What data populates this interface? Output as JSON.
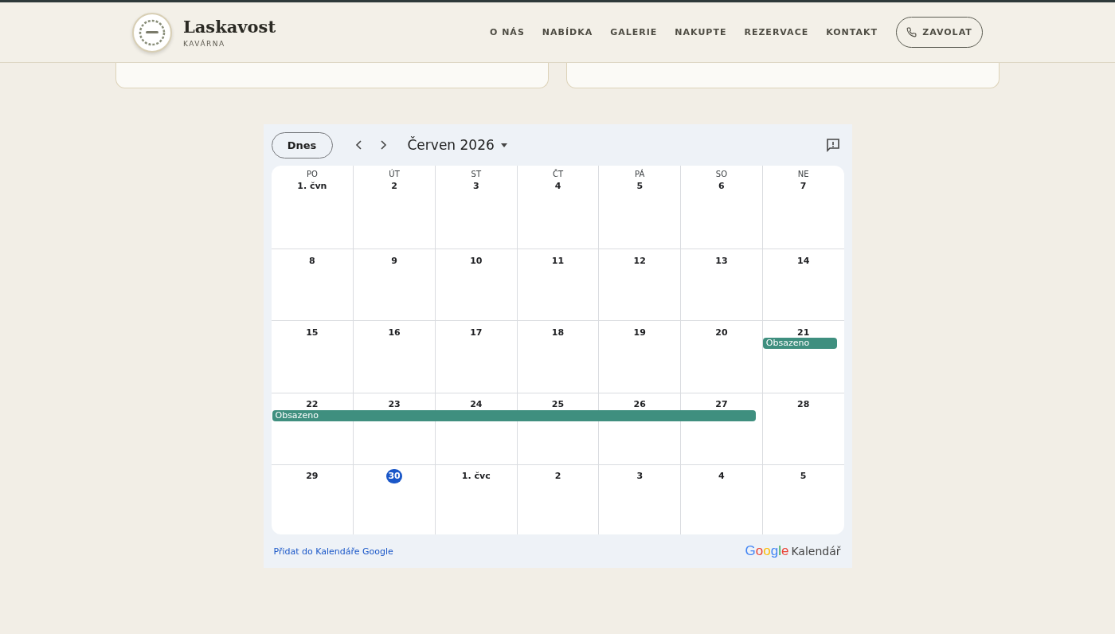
{
  "header": {
    "brand": "Laskavost",
    "tagline": "KAVÁRNA",
    "nav": [
      "O NÁS",
      "NABÍDKA",
      "GALERIE",
      "NAKUPTE",
      "REZERVACE",
      "KONTAKT"
    ],
    "call_button": "ZAVOLAT"
  },
  "calendar": {
    "today_button": "Dnes",
    "month": "Červen 2026",
    "weekdays": [
      "PO",
      "ÚT",
      "ST",
      "ČT",
      "PÁ",
      "SO",
      "NE"
    ],
    "weeks": [
      {
        "days": [
          {
            "label": "1. čvn",
            "today": false,
            "booked": false
          },
          {
            "label": "2",
            "today": false,
            "booked": false
          },
          {
            "label": "3",
            "today": false,
            "booked": false
          },
          {
            "label": "4",
            "today": false,
            "booked": false
          },
          {
            "label": "5",
            "today": false,
            "booked": false
          },
          {
            "label": "6",
            "today": false,
            "booked": false
          },
          {
            "label": "7",
            "today": false,
            "booked": false
          }
        ]
      },
      {
        "days": [
          {
            "label": "8",
            "today": false,
            "booked": false
          },
          {
            "label": "9",
            "today": false,
            "booked": false
          },
          {
            "label": "10",
            "today": false,
            "booked": false
          },
          {
            "label": "11",
            "today": false,
            "booked": false
          },
          {
            "label": "12",
            "today": false,
            "booked": false
          },
          {
            "label": "13",
            "today": false,
            "booked": false
          },
          {
            "label": "14",
            "today": false,
            "booked": false
          }
        ]
      },
      {
        "days": [
          {
            "label": "15",
            "today": false,
            "booked": false
          },
          {
            "label": "16",
            "today": false,
            "booked": false
          },
          {
            "label": "17",
            "today": false,
            "booked": false
          },
          {
            "label": "18",
            "today": false,
            "booked": false
          },
          {
            "label": "19",
            "today": false,
            "booked": false
          },
          {
            "label": "20",
            "today": false,
            "booked": false
          },
          {
            "label": "21",
            "today": false,
            "booked": true,
            "event": "Obsazeno"
          }
        ]
      },
      {
        "days": [
          {
            "label": "22",
            "today": false,
            "booked": true,
            "event": "Obsazeno"
          },
          {
            "label": "23",
            "today": false,
            "booked": true
          },
          {
            "label": "24",
            "today": false,
            "booked": true
          },
          {
            "label": "25",
            "today": false,
            "booked": true
          },
          {
            "label": "26",
            "today": false,
            "booked": true
          },
          {
            "label": "27",
            "today": false,
            "booked": true
          },
          {
            "label": "28",
            "today": false,
            "booked": false
          }
        ]
      },
      {
        "days": [
          {
            "label": "29",
            "today": false,
            "booked": false
          },
          {
            "label": "30",
            "today": true,
            "booked": false
          },
          {
            "label": "1. čvc",
            "today": false,
            "booked": false
          },
          {
            "label": "2",
            "today": false,
            "booked": false
          },
          {
            "label": "3",
            "today": false,
            "booked": false
          },
          {
            "label": "4",
            "today": false,
            "booked": false
          },
          {
            "label": "5",
            "today": false,
            "booked": false
          }
        ]
      }
    ],
    "add_link": "Přidat do Kalendáře Google",
    "brand_logo": "Google",
    "brand_name": "Kalendář"
  }
}
